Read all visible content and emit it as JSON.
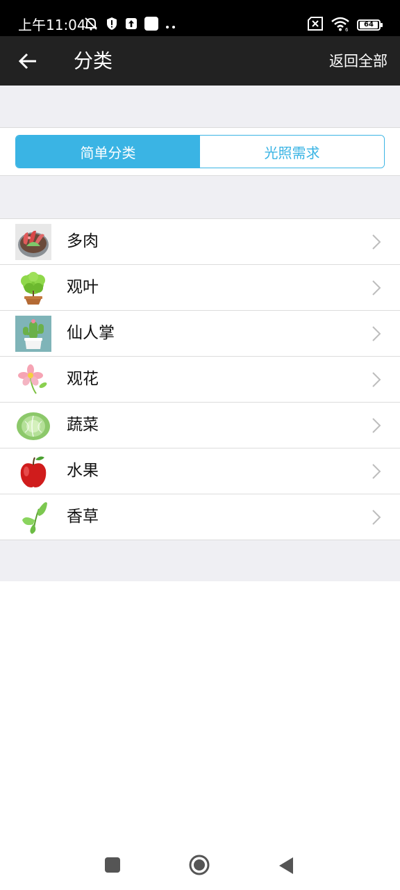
{
  "status_bar": {
    "time": "上午11:04",
    "battery": "64",
    "left_icons": [
      "notifications-muted-icon",
      "shield-alert-icon",
      "upload-icon",
      "square-icon",
      "more-dots-icon"
    ],
    "right_icons": [
      "no-sim-icon",
      "wifi-icon",
      "battery-icon"
    ]
  },
  "header": {
    "title": "分类",
    "action_label": "返回全部",
    "background": "#222222"
  },
  "segments": [
    {
      "label": "简单分类",
      "active": true
    },
    {
      "label": "光照需求",
      "active": false
    }
  ],
  "accent_color": "#3ab4e4",
  "categories": [
    {
      "label": "多肉",
      "icon": "succulent-icon"
    },
    {
      "label": "观叶",
      "icon": "foliage-plant-icon"
    },
    {
      "label": "仙人掌",
      "icon": "cactus-icon"
    },
    {
      "label": "观花",
      "icon": "flower-icon"
    },
    {
      "label": "蔬菜",
      "icon": "cabbage-icon"
    },
    {
      "label": "水果",
      "icon": "apple-icon"
    },
    {
      "label": "香草",
      "icon": "herb-leaves-icon"
    }
  ],
  "nav": [
    "recents-button",
    "home-button",
    "back-nav-button"
  ]
}
